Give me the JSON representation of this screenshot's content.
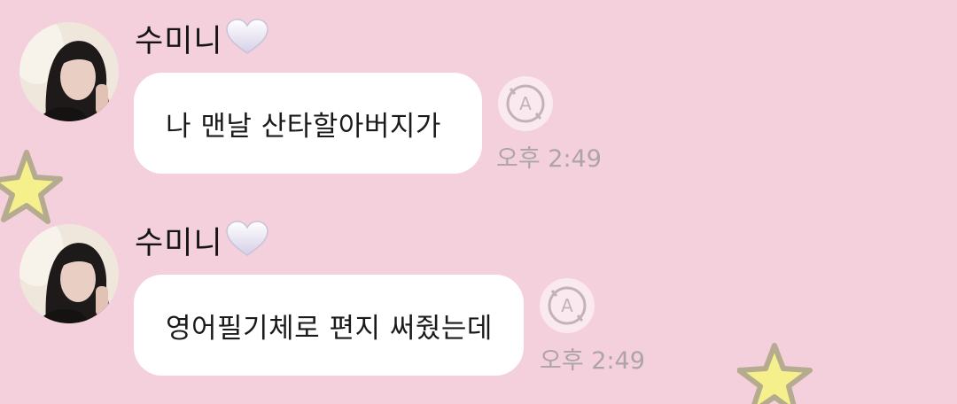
{
  "colors": {
    "background": "#f4d0dd",
    "bubble": "#ffffff",
    "timestamp": "#ada4a7",
    "star_fill": "#f6f08c",
    "star_outline": "#b5ab8e"
  },
  "messages": [
    {
      "sender": "수미니",
      "sender_icon": "white-heart-icon",
      "text": "나 맨날 산타할아버지가",
      "time": "오후 2:49",
      "action_icon": "translate-icon"
    },
    {
      "sender": "수미니",
      "sender_icon": "white-heart-icon",
      "text": "영어필기체로 편지 써줬는데",
      "time": "오후 2:49",
      "action_icon": "translate-icon"
    }
  ],
  "decorations": [
    "star-sticker-icon",
    "star-sticker-icon"
  ]
}
